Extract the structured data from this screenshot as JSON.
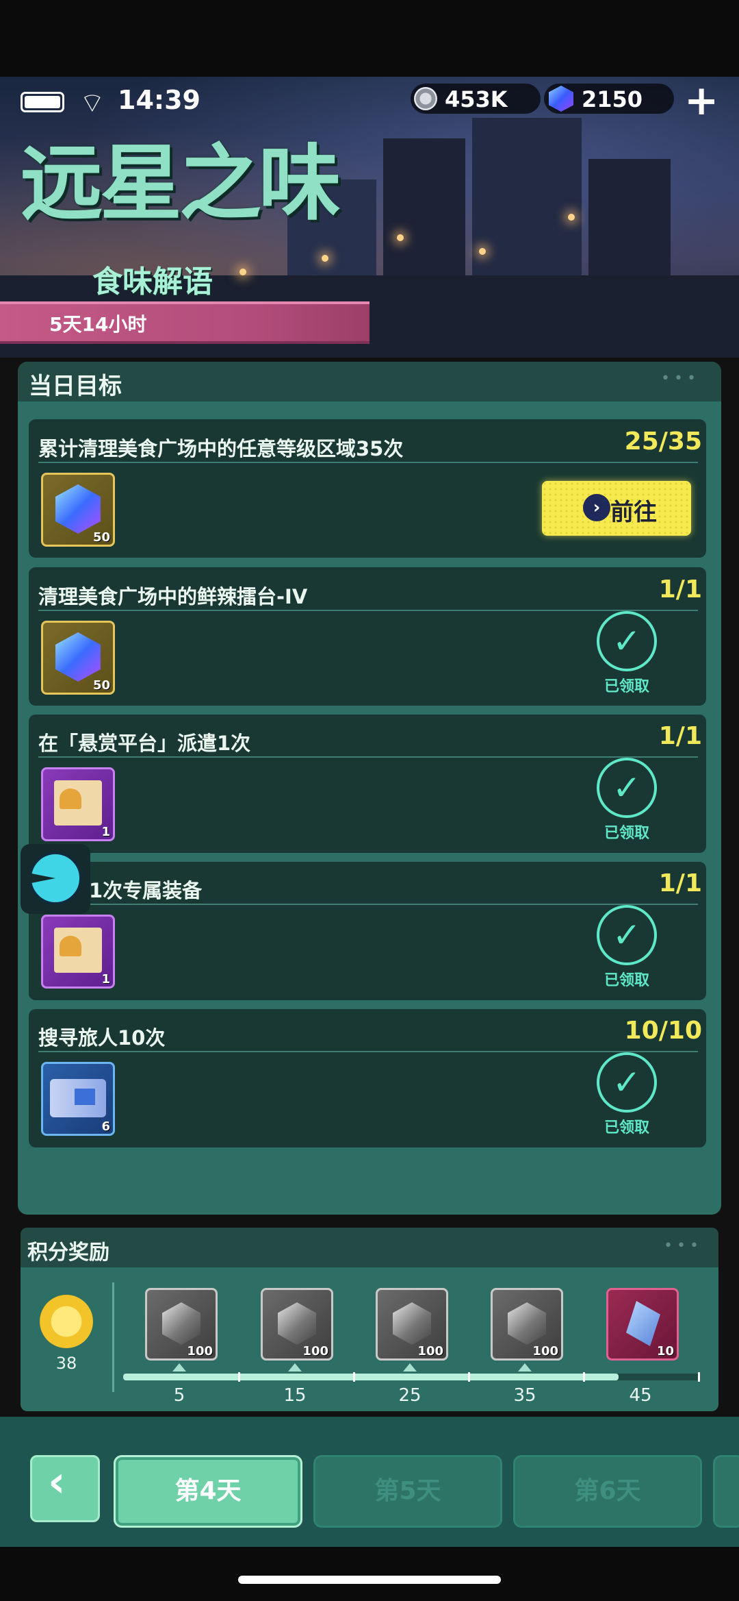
{
  "status_bar": {
    "time": "14:39"
  },
  "currency": {
    "coins": "453K",
    "gems": "2150",
    "coin_icon": "silver-coin-icon",
    "gem_icon": "blue-gem-icon",
    "add_icon": "plus-icon"
  },
  "banner": {
    "title": "远星之味",
    "subtitle": "食味解语",
    "timer": "5天14小时"
  },
  "daily_goals": {
    "title": "当日目标",
    "tasks": [
      {
        "title": "累计清理美食广场中的任意等级区域35次",
        "progress": "25/35",
        "reward_qty": "50",
        "reward_icon": "gem-cube-icon",
        "action": "前往"
      },
      {
        "title": "清理美食广场中的鲜辣擂台-IV",
        "progress": "1/1",
        "reward_qty": "50",
        "reward_icon": "gem-cube-icon",
        "status": "已领取"
      },
      {
        "title": "在「悬赏平台」派遣1次",
        "progress": "1/1",
        "reward_qty": "1",
        "reward_icon": "food-card-icon",
        "status": "已领取"
      },
      {
        "title": "1次专属装备",
        "progress": "1/1",
        "reward_qty": "1",
        "reward_icon": "food-card-icon",
        "status": "已领取"
      },
      {
        "title": "搜寻旅人10次",
        "progress": "10/10",
        "reward_qty": "6",
        "reward_icon": "ticket-icon",
        "status": "已领取"
      }
    ]
  },
  "points_rewards": {
    "title": "积分奖励",
    "points": "38",
    "progress_fraction": 0.86,
    "milestones": [
      {
        "label": "5",
        "qty": "100",
        "icon": "silver-cube-icon"
      },
      {
        "label": "15",
        "qty": "100",
        "icon": "silver-cube-icon"
      },
      {
        "label": "25",
        "qty": "100",
        "icon": "silver-cube-icon"
      },
      {
        "label": "35",
        "qty": "100",
        "icon": "silver-cube-icon"
      },
      {
        "label": "45",
        "qty": "10",
        "icon": "crystal-icon"
      }
    ]
  },
  "tabs": {
    "day4": "第4天",
    "day5": "第5天",
    "day6": "第6天"
  },
  "colors": {
    "accent": "#6fd1a8",
    "progress": "#f2e95a",
    "claimed": "#5fe8c8",
    "timer": "#c45a86"
  }
}
